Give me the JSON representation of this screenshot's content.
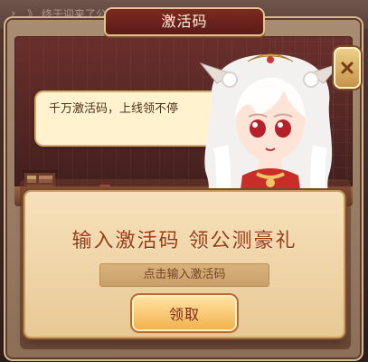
{
  "background": {
    "ticker_text": "》 终于迎来了公"
  },
  "dialog": {
    "title": "激活码",
    "speech_text": "千万激活码，上线领不停",
    "promo_text": "输入激活码 领公测豪礼",
    "input": {
      "placeholder": "点击输入激活码",
      "value": ""
    },
    "claim_button_label": "领取"
  },
  "icons": {
    "close": "close-icon",
    "bookshelf": "bookshelf-icon",
    "scroll": "scroll-icon",
    "teapot": "teapot-icon",
    "character": "character-portrait"
  },
  "colors": {
    "title_bg": "#7c2a22",
    "promo_text": "#9b3a11",
    "button_gold": "#f3b24f",
    "panel_bg": "#f7e1bb"
  }
}
